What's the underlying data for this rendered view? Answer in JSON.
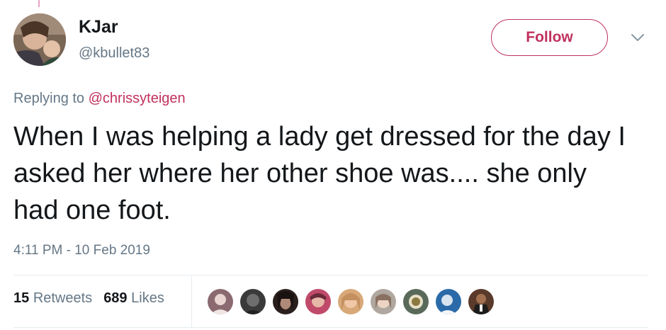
{
  "author": {
    "display_name": "KJar",
    "handle": "@kbullet83"
  },
  "follow_button": {
    "label": "Follow"
  },
  "reply": {
    "prefix": "Replying to",
    "mention": "@chrissyteigen"
  },
  "tweet": {
    "text": "When I was helping a lady get dressed for the day I asked her where her other shoe was.... she only had one foot.",
    "timestamp": "4:11 PM - 10 Feb 2019"
  },
  "stats": {
    "retweets_count": "15",
    "retweets_label": "Retweets",
    "likes_count": "689",
    "likes_label": "Likes"
  },
  "colors": {
    "accent": "#c0315e",
    "secondary_text": "#657786",
    "primary_text": "#14171a",
    "divider": "#e6ecf0"
  },
  "icons": {
    "caret": "chevron-down-icon"
  }
}
